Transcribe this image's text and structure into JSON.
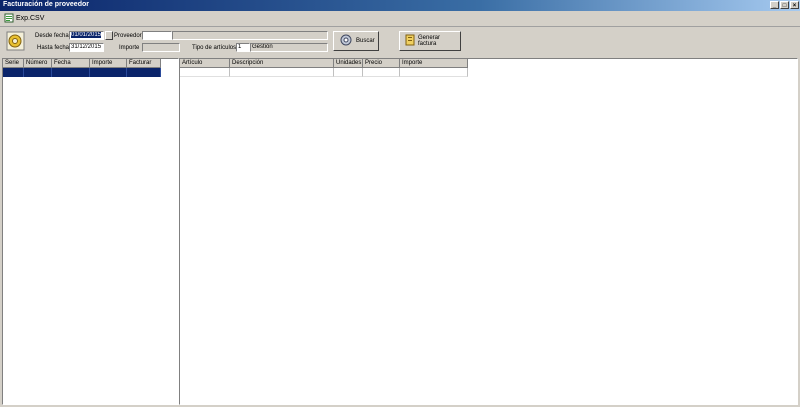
{
  "window": {
    "title": "Facturación de proveedor"
  },
  "menu": {
    "export_label": "Exp.CSV"
  },
  "filters": {
    "desde_label": "Desde fecha",
    "desde_value": "01/01/2015",
    "hasta_label": "Hasta fecha",
    "hasta_value": "31/12/2015",
    "proveedor_label": "Proveedor",
    "proveedor_code": "",
    "proveedor_name": "",
    "importe_label": "Importe",
    "importe_value": "",
    "tipo_label": "Tipo de artículos",
    "tipo_code": "1",
    "tipo_name": "Gestión"
  },
  "actions": {
    "buscar_label": "Buscar",
    "generar_label": "Generar factura"
  },
  "left_table": {
    "columns": [
      "Serie",
      "Número",
      "Fecha",
      "Importe",
      "Facturar"
    ]
  },
  "right_table": {
    "columns": [
      "Artículo",
      "Descripción",
      "Unidades",
      "Precio",
      "Importe"
    ]
  },
  "colors": {
    "title_start": "#0a246a",
    "selection": "#0a246a",
    "face": "#d4d0c8"
  }
}
